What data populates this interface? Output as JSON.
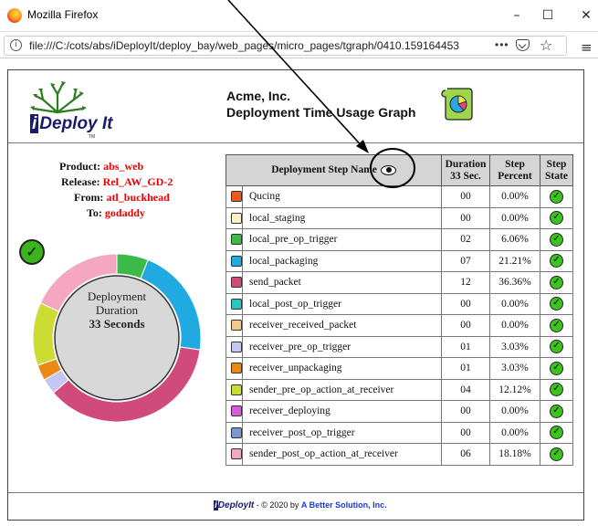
{
  "browser": {
    "title": "Mozilla Firefox",
    "url": "file:///C:/cots/abs/iDeployIt/deploy_bay/web_pages/micro_pages/tgraph/0410.159164453",
    "url_more": "•••",
    "minimize": "–",
    "maximize": "☐",
    "close": "✕"
  },
  "header": {
    "logo_i": "i",
    "logo_rest": "Deploy ",
    "logo_it": "It",
    "logo_tm": "TM",
    "company": "Acme, Inc.",
    "graph_title": "Deployment Time Usage Graph"
  },
  "job": {
    "product_label": "Product:",
    "product": "abs_web",
    "release_label": "Release:",
    "release": "Rel_AW_GD-2",
    "from_label": "From:",
    "from": "atl_buckhead",
    "to_label": "To:",
    "to": "godaddy"
  },
  "donut": {
    "line1": "Deployment",
    "line2": "Duration",
    "line3": "33 Seconds",
    "check": "✓"
  },
  "table": {
    "col_name": "Deployment Step Name",
    "col_duration": "Duration",
    "col_duration_sub": "33 Sec.",
    "col_percent": "Step",
    "col_percent_sub": "Percent",
    "col_state": "Step",
    "col_state_sub": "State",
    "rows": [
      {
        "name": "Qucing",
        "duration": "00",
        "percent": "0.00%",
        "color": "#ee5a1d"
      },
      {
        "name": "local_staging",
        "duration": "00",
        "percent": "0.00%",
        "color": "#f7f1c5"
      },
      {
        "name": "local_pre_op_trigger",
        "duration": "02",
        "percent": "6.06%",
        "color": "#3db94a"
      },
      {
        "name": "local_packaging",
        "duration": "07",
        "percent": "21.21%",
        "color": "#21a9e1"
      },
      {
        "name": "send_packet",
        "duration": "12",
        "percent": "36.36%",
        "color": "#d14a7c"
      },
      {
        "name": "local_post_op_trigger",
        "duration": "00",
        "percent": "0.00%",
        "color": "#2bc4be"
      },
      {
        "name": "receiver_received_packet",
        "duration": "00",
        "percent": "0.00%",
        "color": "#f1c98c"
      },
      {
        "name": "receiver_pre_op_trigger",
        "duration": "01",
        "percent": "3.03%",
        "color": "#c5c6f2"
      },
      {
        "name": "receiver_unpackaging",
        "duration": "01",
        "percent": "3.03%",
        "color": "#e88a13"
      },
      {
        "name": "sender_pre_op_action_at_receiver",
        "duration": "04",
        "percent": "12.12%",
        "color": "#cbdc33"
      },
      {
        "name": "receiver_deploying",
        "duration": "00",
        "percent": "0.00%",
        "color": "#d95bdc"
      },
      {
        "name": "receiver_post_op_trigger",
        "duration": "00",
        "percent": "0.00%",
        "color": "#7c98d0"
      },
      {
        "name": "sender_post_op_action_at_receiver",
        "duration": "06",
        "percent": "18.18%",
        "color": "#f5a6c0"
      }
    ]
  },
  "footer": {
    "logo_i": "i",
    "logo_rest": "Deploy",
    "logo_it": "It",
    "copyright": " - © 2020 by ",
    "company": "A Better Solution, Inc."
  }
}
